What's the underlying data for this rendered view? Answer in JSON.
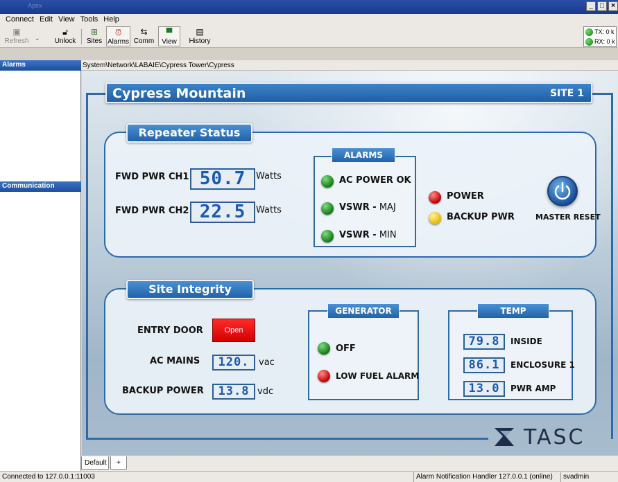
{
  "window": {
    "app_title": "Apex"
  },
  "menu": [
    "Connect",
    "Edit",
    "View",
    "Tools",
    "Help"
  ],
  "toolbar": {
    "refresh": "Refresh",
    "unlock": "Unlock",
    "sites": "Sites",
    "alarms": "Alarms",
    "comm": "Comm",
    "view": "View",
    "history": "History",
    "tx": "TX: 0 k",
    "rx": "RX: 0 k"
  },
  "sidebar": {
    "alarms_header": "Alarms",
    "communication_header": "Communication"
  },
  "breadcrumb": "System\\Network\\LABAIE\\Cypress Tower\\Cypress",
  "site": {
    "name": "Cypress Mountain",
    "number": "SITE 1"
  },
  "repeater_status": {
    "title": "Repeater Status",
    "fwd1_label": "FWD PWR CH1",
    "fwd1_value": "50.7",
    "fwd1_unit": "Watts",
    "fwd2_label": "FWD PWR CH2",
    "fwd2_value": "22.5",
    "fwd2_unit": "Watts",
    "alarms_header": "ALARMS",
    "alarm_ac_power": "AC POWER OK",
    "alarm_vswr_maj_bold": "VSWR -",
    "alarm_vswr_maj_sfx": " MAJ",
    "alarm_vswr_min_bold": "VSWR -",
    "alarm_vswr_min_sfx": " MIN",
    "power": "POWER",
    "backup_pwr": "BACKUP PWR",
    "master_reset": "MASTER RESET"
  },
  "site_integrity": {
    "title": "Site Integrity",
    "entry_door": "ENTRY DOOR",
    "entry_door_state": "Open",
    "ac_mains": "AC MAINS",
    "ac_mains_value": "120.",
    "ac_mains_unit": "vac",
    "backup_power": "BACKUP POWER",
    "backup_power_value": "13.8",
    "backup_power_unit": "vdc",
    "generator_header": "GENERATOR",
    "gen_off": "OFF",
    "gen_low_fuel": "LOW FUEL ALARM",
    "temp_header": "TEMP",
    "temp_inside_value": "79.8",
    "temp_inside": "INSIDE",
    "temp_enc_value": "86.1",
    "temp_enc": "ENCLOSURE 1",
    "temp_pwr_value": "13.0",
    "temp_pwr": "PWR AMP"
  },
  "logo_text": "TASC",
  "tabs": {
    "default": "Default",
    "add": "+"
  },
  "status": {
    "connected": "Connected to 127.0.0.1:11003",
    "handler": "Alarm Notification Handler 127.0.0.1 (online)",
    "user": "svadmin"
  },
  "colors": {
    "accent_blue": "#2e6aa8",
    "lcd_digits": "#1a58b8",
    "led_green": "#167a16",
    "led_red": "#c00000",
    "led_yellow": "#e6b800",
    "open_red": "#ff0000"
  }
}
